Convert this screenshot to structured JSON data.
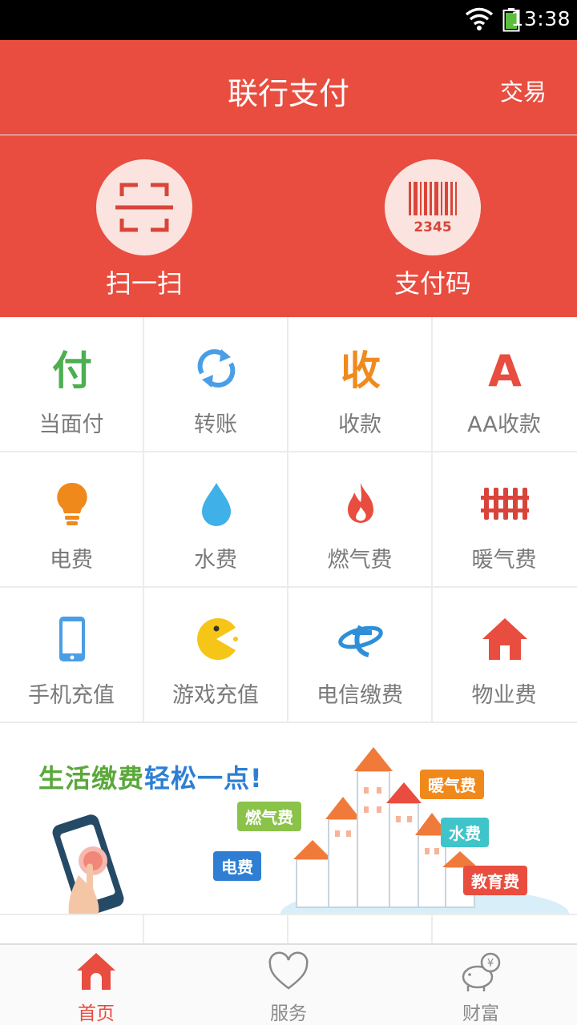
{
  "status": {
    "time": "13:38"
  },
  "header": {
    "title": "联行支付",
    "action": "交易"
  },
  "hero": [
    {
      "label": "扫一扫",
      "icon": "scan-icon"
    },
    {
      "label": "支付码",
      "icon": "barcode-icon",
      "code_text": "2345"
    }
  ],
  "grid": [
    {
      "label": "当面付",
      "icon": "pay-character-icon",
      "glyph": "付",
      "color": "#4caf50"
    },
    {
      "label": "转账",
      "icon": "refresh-arrows-icon",
      "color": "#4a9ee6"
    },
    {
      "label": "收款",
      "icon": "receive-character-icon",
      "glyph": "收",
      "color": "#f08a1c"
    },
    {
      "label": "AA收款",
      "icon": "letter-a-icon",
      "glyph": "A",
      "color": "#e84d3f"
    },
    {
      "label": "电费",
      "icon": "lightbulb-icon",
      "color": "#f0891c"
    },
    {
      "label": "水费",
      "icon": "water-drop-icon",
      "color": "#3fb0e8"
    },
    {
      "label": "燃气费",
      "icon": "flame-icon",
      "color": "#e84d3f"
    },
    {
      "label": "暖气费",
      "icon": "radiator-icon",
      "color": "#d9443a"
    },
    {
      "label": "手机充值",
      "icon": "phone-icon",
      "color": "#4a9ee6"
    },
    {
      "label": "游戏充值",
      "icon": "pacman-icon",
      "color": "#f5c518"
    },
    {
      "label": "电信缴费",
      "icon": "telecom-icon",
      "color": "#2e8fd8"
    },
    {
      "label": "物业费",
      "icon": "house-icon",
      "color": "#e84d3f"
    }
  ],
  "banner": {
    "slogan_part1": "生活缴费",
    "slogan_part2": "轻松一点!",
    "tags": [
      "燃气费",
      "暖气费",
      "水费",
      "电费",
      "教育费"
    ]
  },
  "tabs": [
    {
      "label": "首页",
      "icon": "home-icon",
      "active": true
    },
    {
      "label": "服务",
      "icon": "heart-icon",
      "active": false
    },
    {
      "label": "财富",
      "icon": "piggy-bank-icon",
      "active": false
    }
  ],
  "colors": {
    "brand": "#e84d3f",
    "hero_circle": "#fbe4df",
    "grid_line": "#ececec"
  }
}
